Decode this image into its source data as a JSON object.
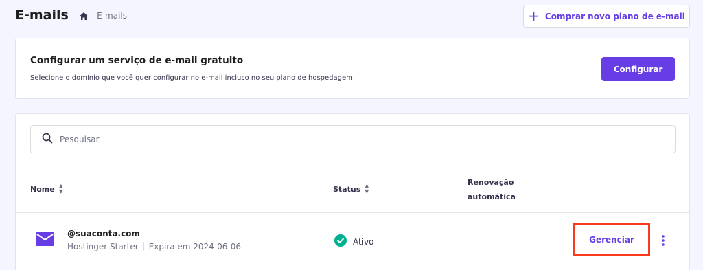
{
  "header": {
    "title": "E-mails",
    "breadcrumb": "- E-mails",
    "buy_button": "Comprar novo plano de e-mail"
  },
  "config": {
    "title": "Configurar um serviço de e-mail gratuito",
    "description": "Selecione o domínio que você quer configurar no e-mail incluso no seu plano de hospedagem.",
    "button": "Configurar"
  },
  "search": {
    "placeholder": "Pesquisar"
  },
  "table": {
    "columns": {
      "name": "Nome",
      "status": "Status",
      "renewal_line1": "Renovação",
      "renewal_line2": "automática"
    },
    "rows": [
      {
        "domain": "@suaconta.com",
        "plan": "Hostinger Starter",
        "expires": "Expira em 2024-06-06",
        "status": "Ativo",
        "action": "Gerenciar"
      }
    ]
  },
  "icons": {
    "home": "home-icon",
    "plus": "plus-icon",
    "search": "search-icon",
    "sort": "sort-icon",
    "mail": "mail-icon",
    "check": "check-circle-icon",
    "more": "more-vertical-icon"
  },
  "colors": {
    "accent": "#673de6",
    "success": "#00b090",
    "highlight": "#fc3a1c",
    "background": "#f4f5ff"
  }
}
